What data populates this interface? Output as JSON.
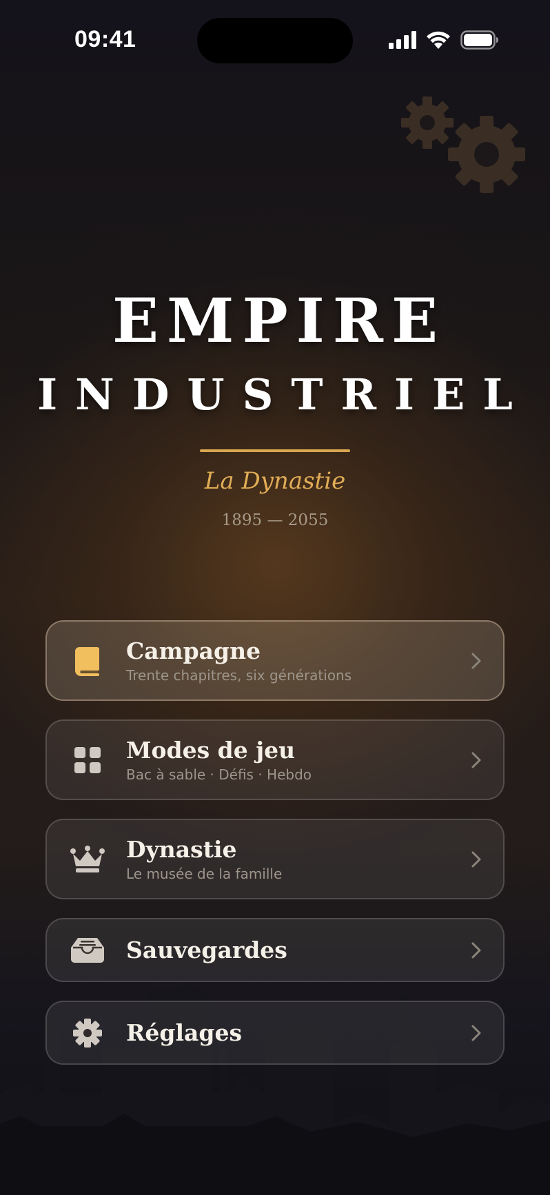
{
  "status_bar": {
    "time": "09:41"
  },
  "title": {
    "line1": "EMPIRE",
    "line2": "INDUSTRIEL",
    "subtitle": "La Dynastie",
    "years": "1895 — 2055"
  },
  "colors": {
    "accent": "#e0ac56",
    "book_icon": "#f2bf5e",
    "icon_neutral": "#cfc9c2"
  },
  "menu": {
    "items": [
      {
        "title": "Campagne",
        "subtitle": "Trente chapitres, six générations",
        "icon": "book-icon"
      },
      {
        "title": "Modes de jeu",
        "subtitle": "Bac à sable · Défis · Hebdo",
        "icon": "grid-icon"
      },
      {
        "title": "Dynastie",
        "subtitle": "Le musée de la famille",
        "icon": "crown-icon"
      },
      {
        "title": "Sauvegardes",
        "icon": "inbox-tray-icon"
      },
      {
        "title": "Réglages",
        "icon": "gear-icon"
      }
    ]
  }
}
